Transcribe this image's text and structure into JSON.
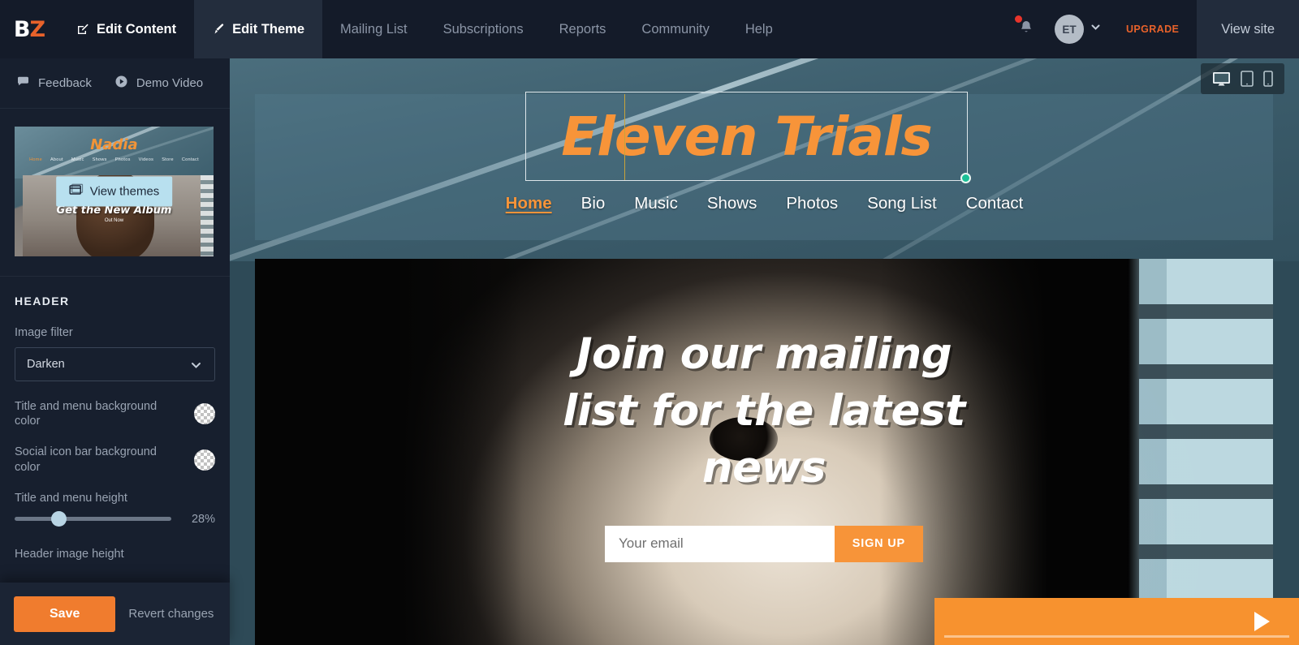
{
  "app": {
    "logo_b": "B",
    "logo_z": "Z"
  },
  "topnav": {
    "tabs": [
      {
        "label": "Edit Content",
        "icon": "pencil-square-icon",
        "state": "strong"
      },
      {
        "label": "Edit Theme",
        "icon": "paintbrush-icon",
        "state": "active"
      },
      {
        "label": "Mailing List",
        "icon": "",
        "state": "normal"
      },
      {
        "label": "Subscriptions",
        "icon": "",
        "state": "normal"
      },
      {
        "label": "Reports",
        "icon": "",
        "state": "normal"
      },
      {
        "label": "Community",
        "icon": "",
        "state": "normal"
      },
      {
        "label": "Help",
        "icon": "",
        "state": "normal"
      }
    ],
    "notification_icon": "bell-icon",
    "avatar_initials": "ET",
    "avatar_chevron": "chevron-down-icon",
    "upgrade_label": "UPGRADE",
    "view_site_label": "View site"
  },
  "sidebar": {
    "links": [
      {
        "label": "Feedback",
        "icon": "speech-bubble-icon"
      },
      {
        "label": "Demo Video",
        "icon": "play-circle-icon"
      }
    ],
    "theme_thumbnail": {
      "site_title": "Nadia",
      "nav": [
        "Home",
        "About",
        "Music",
        "Shows",
        "Photos",
        "Videos",
        "Store",
        "Contact"
      ],
      "album_text": "Get the New Album",
      "album_sub": "Out Now",
      "button_label": "View themes",
      "button_icon": "browser-window-icon"
    },
    "panel": {
      "title": "HEADER",
      "image_filter": {
        "label": "Image filter",
        "value": "Darken",
        "chevron_icon": "chevron-down-icon"
      },
      "title_menu_bg": {
        "label": "Title and menu background color",
        "swatch_icon": "transparent-color-swatch"
      },
      "social_bar_bg": {
        "label": "Social icon bar background color",
        "swatch_icon": "transparent-color-swatch"
      },
      "title_menu_height": {
        "label": "Title and menu height",
        "value": "28%",
        "percent": 28
      },
      "header_image_height": {
        "label": "Header image height"
      }
    },
    "save_bar": {
      "save_label": "Save",
      "revert_label": "Revert changes"
    }
  },
  "preview": {
    "device_toggles": [
      {
        "name": "desktop",
        "icon": "desktop-icon",
        "active": true
      },
      {
        "name": "tablet",
        "icon": "tablet-icon",
        "active": false
      },
      {
        "name": "mobile",
        "icon": "mobile-icon",
        "active": false
      }
    ],
    "site": {
      "title": "Eleven Trials",
      "nav": [
        {
          "label": "Home",
          "active": true
        },
        {
          "label": "Bio",
          "active": false
        },
        {
          "label": "Music",
          "active": false
        },
        {
          "label": "Shows",
          "active": false
        },
        {
          "label": "Photos",
          "active": false
        },
        {
          "label": "Song List",
          "active": false
        },
        {
          "label": "Contact",
          "active": false
        }
      ],
      "hero_heading": "Join our mailing list for the latest news",
      "signup": {
        "placeholder": "Your email",
        "value": "",
        "button_label": "SIGN UP"
      },
      "player": {
        "play_icon": "play-triangle-icon"
      }
    }
  },
  "colors": {
    "accent_orange": "#f79439",
    "brand_orange": "#e8622a",
    "save_orange": "#f07c2e",
    "nav_dark": "#141b29",
    "sidebar_dark": "#171f2e",
    "handle_green": "#1bbf96",
    "notification_red": "#e8342b"
  }
}
